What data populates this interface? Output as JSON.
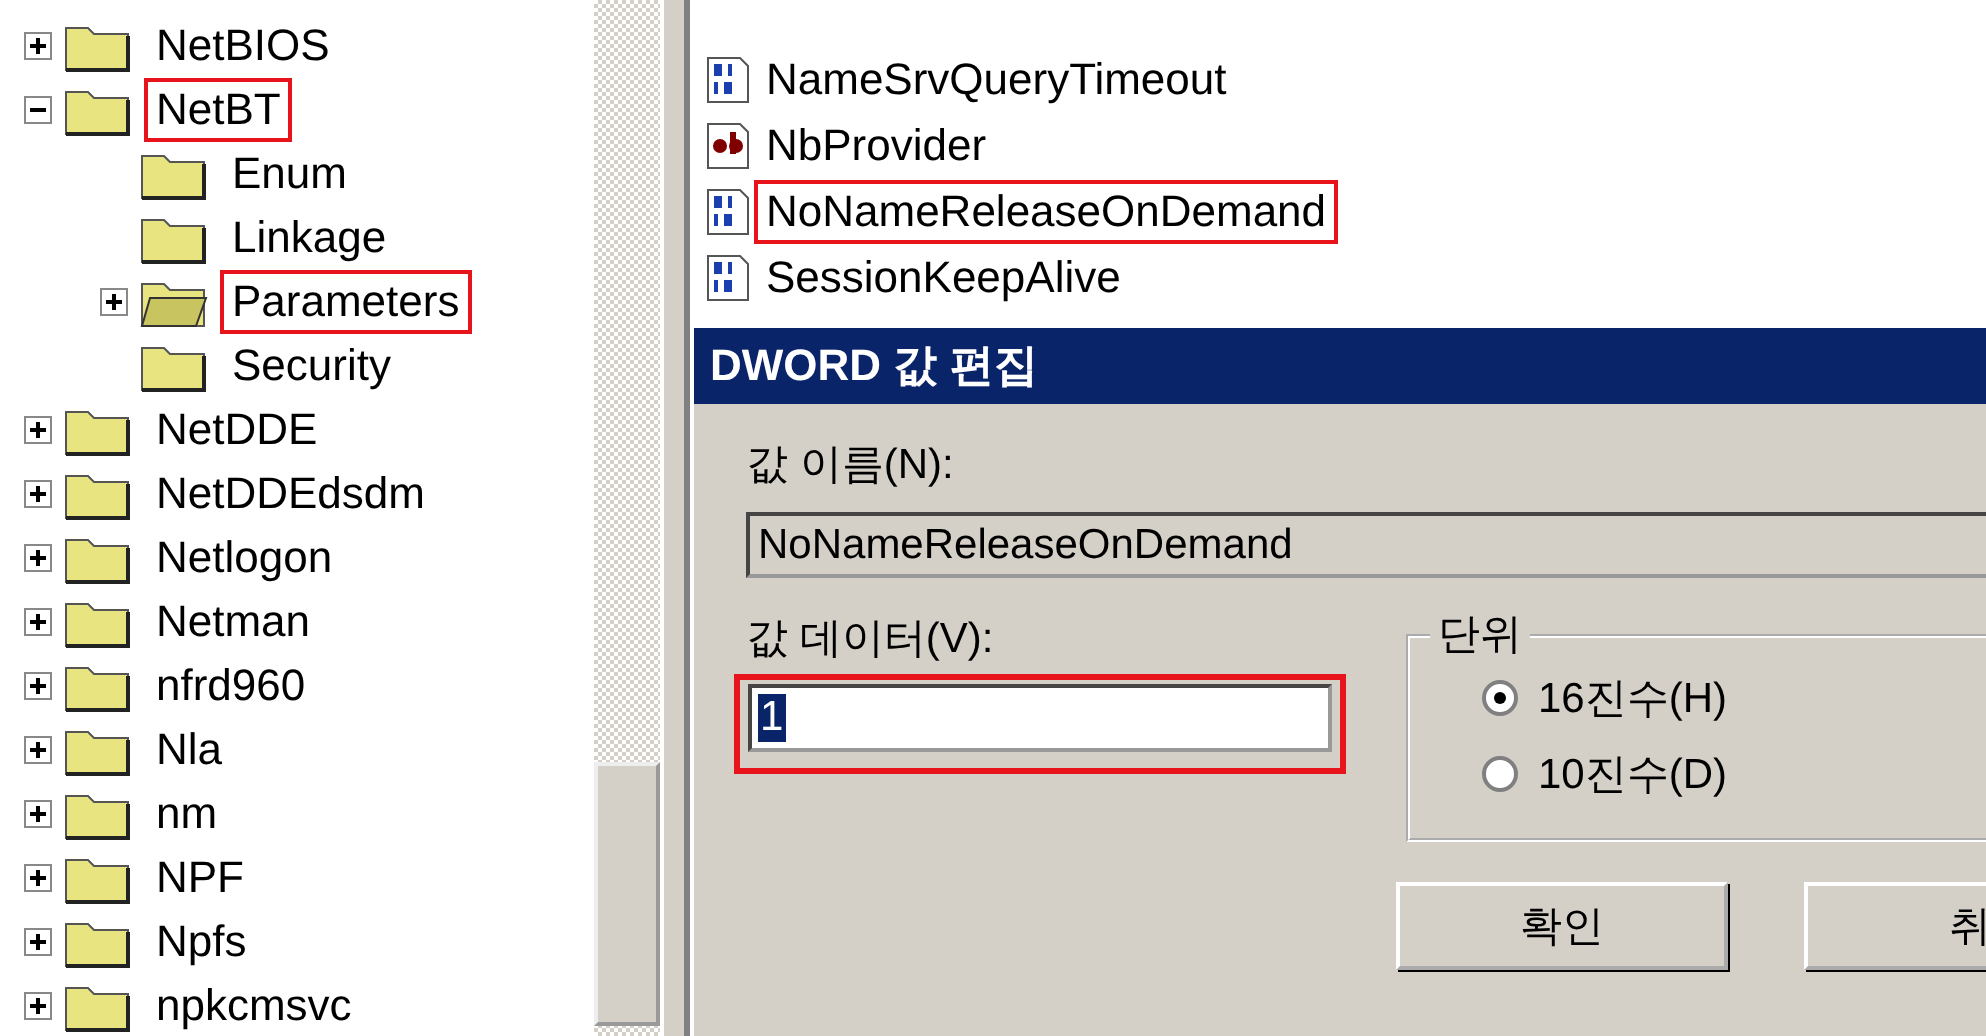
{
  "tree": [
    {
      "label": "NetBIOS",
      "expanded": false,
      "highlighted": false
    },
    {
      "label": "NetBT",
      "expanded": true,
      "highlighted": true,
      "children": [
        {
          "label": "Enum",
          "highlighted": false
        },
        {
          "label": "Linkage",
          "highlighted": false
        },
        {
          "label": "Parameters",
          "expanded": false,
          "selected": true,
          "highlighted": true
        },
        {
          "label": "Security",
          "highlighted": false
        }
      ]
    },
    {
      "label": "NetDDE",
      "expanded": false,
      "highlighted": false
    },
    {
      "label": "NetDDEdsdm",
      "expanded": false,
      "highlighted": false
    },
    {
      "label": "Netlogon",
      "expanded": false,
      "highlighted": false
    },
    {
      "label": "Netman",
      "expanded": false,
      "highlighted": false
    },
    {
      "label": "nfrd960",
      "expanded": false,
      "highlighted": false
    },
    {
      "label": "Nla",
      "expanded": false,
      "highlighted": false
    },
    {
      "label": "nm",
      "expanded": false,
      "highlighted": false
    },
    {
      "label": "NPF",
      "expanded": false,
      "highlighted": false
    },
    {
      "label": "Npfs",
      "expanded": false,
      "highlighted": false
    },
    {
      "label": "npkcmsvc",
      "expanded": false,
      "highlighted": false
    }
  ],
  "values": [
    {
      "name": "NameSrvQueryTimeout",
      "kind": "binary",
      "highlighted": false
    },
    {
      "name": "NbProvider",
      "kind": "string",
      "highlighted": false
    },
    {
      "name": "NoNameReleaseOnDemand",
      "kind": "binary",
      "highlighted": true
    },
    {
      "name": "SessionKeepAlive",
      "kind": "binary",
      "highlighted": false
    }
  ],
  "dialog": {
    "title": "DWORD 값 편집",
    "name_label": "값 이름(N):",
    "name_value": "NoNameReleaseOnDemand",
    "data_label": "값 데이터(V):",
    "data_value": "1",
    "data_highlighted": true,
    "base_group": {
      "title": "단위",
      "options": [
        {
          "label": "16진수(H)",
          "selected": true
        },
        {
          "label": "10진수(D)",
          "selected": false
        }
      ]
    },
    "buttons": [
      "확인",
      "취"
    ]
  }
}
